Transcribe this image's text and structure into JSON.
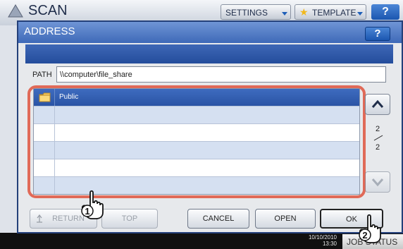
{
  "background": {
    "screen_title": "SCAN",
    "tabs": [
      "SETTINGS",
      "TEMPLATE"
    ],
    "help_label": "?",
    "datetime": "10/10/2010",
    "time": "13:30",
    "job_status": "JOB STATUS"
  },
  "dialog": {
    "title": "ADDRESS",
    "help_label": "?",
    "path_label": "PATH",
    "path_value": "\\\\computer\\file_share",
    "list": {
      "rows": [
        {
          "label": "Public",
          "type": "folder",
          "selected": true
        },
        {
          "label": "",
          "type": "empty"
        },
        {
          "label": "",
          "type": "empty"
        },
        {
          "label": "",
          "type": "empty"
        },
        {
          "label": "",
          "type": "empty"
        },
        {
          "label": "",
          "type": "empty"
        }
      ]
    },
    "page": {
      "current": "2",
      "total": "2"
    },
    "buttons": {
      "return": "RETURN",
      "top": "TOP",
      "cancel": "CANCEL",
      "open": "OPEN",
      "ok": "OK"
    },
    "callouts": [
      "1",
      "2"
    ]
  },
  "colors": {
    "accent": "#2a54a5",
    "highlight": "#e06a58",
    "dialog_border": "#24407a"
  }
}
